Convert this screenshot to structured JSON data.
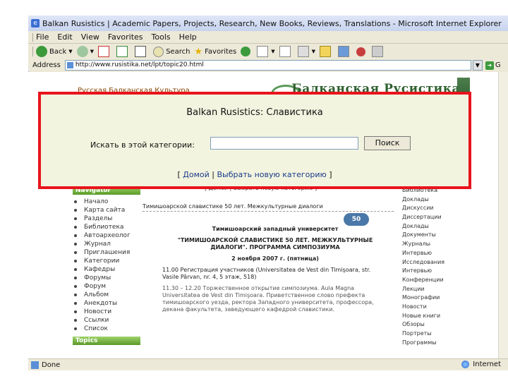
{
  "window": {
    "title": "Balkan Rusistics | Academic Papers, Projects, Research, New Books, Reviews, Translations - Microsoft Internet Explorer"
  },
  "menu": [
    "File",
    "Edit",
    "View",
    "Favorites",
    "Tools",
    "Help"
  ],
  "toolbar": {
    "back": "Back",
    "search": "Search",
    "favorites": "Favorites"
  },
  "address": {
    "label": "Address",
    "url": "http://www.rusistika.net/lpt/topic20.html",
    "go": "G"
  },
  "dialog": {
    "title": "Balkan Rusistics: Славистика",
    "search_label": "Искать в этой категории:",
    "search_value": "",
    "search_button": "Поиск",
    "link_open": "[",
    "link_home": "Домой",
    "link_sep": "|",
    "link_choose": "Выбрать новую категорию",
    "link_close": "]"
  },
  "site": {
    "logo_text": "Балканская Русистика",
    "header_link": "Русская Балканская Культура",
    "nav_head": "Navigator",
    "nav_items": [
      "Начало",
      "Карта сайта",
      "Разделы",
      "Библиотека",
      "Автоархеолог",
      "Журнал",
      "Приглашения",
      "Категории",
      "Кафедры",
      "Форумы",
      "Форум",
      "Альбом",
      "Анекдоты",
      "Новости",
      "Ссылки",
      "Список"
    ],
    "topics_head": "Topics",
    "crumb": "[ Домой | Выбрать новую категорию ]",
    "right_items": [
      "Библиотека",
      "Доклады",
      "Дискуссии",
      "Диссертации",
      "Доклады",
      "Документы",
      "Журналы",
      "Интервью",
      "Исследования",
      "Интервью",
      "Конференции",
      "Лекции",
      "Монографии",
      "Новости",
      "Новые книги",
      "Обзоры",
      "Портреты",
      "Программы"
    ]
  },
  "article": {
    "head": "Тимишоарской славистике 50 лет. Межкультурные диалоги",
    "badge": "50",
    "line1": "Тимишоарский западный университет",
    "line2": "\"ТИМИШОАРСКОЙ СЛАВИСТИКЕ 50 ЛЕТ. МЕЖКУЛЬТУРНЫЕ ДИАЛОГИ\". ПРОГРАММА СИМПОЗИУМА",
    "line3": "2 ноября 2007 г. (пятница)",
    "p1": "11.00 Регистрация участников (Universitatea de Vest din Timişoara, str. Vasile Pârvan, nr. 4, 5 этаж, 518)",
    "p2": "11.30 – 12.20 Торжественное открытие симпозиума. Aula Magna Universitatea de Vest din Timişoara. Приветственное слово префекта тимишоарского уезда, ректора Западного университета, профессора, декана факультета, заведующего кафедрой славистики."
  },
  "status": {
    "left": "Done",
    "right": "Internet"
  },
  "colors": {
    "dialog_border": "#e8141c",
    "dialog_bg": "#f3f4df",
    "nav_green": "#5a9a2a"
  }
}
